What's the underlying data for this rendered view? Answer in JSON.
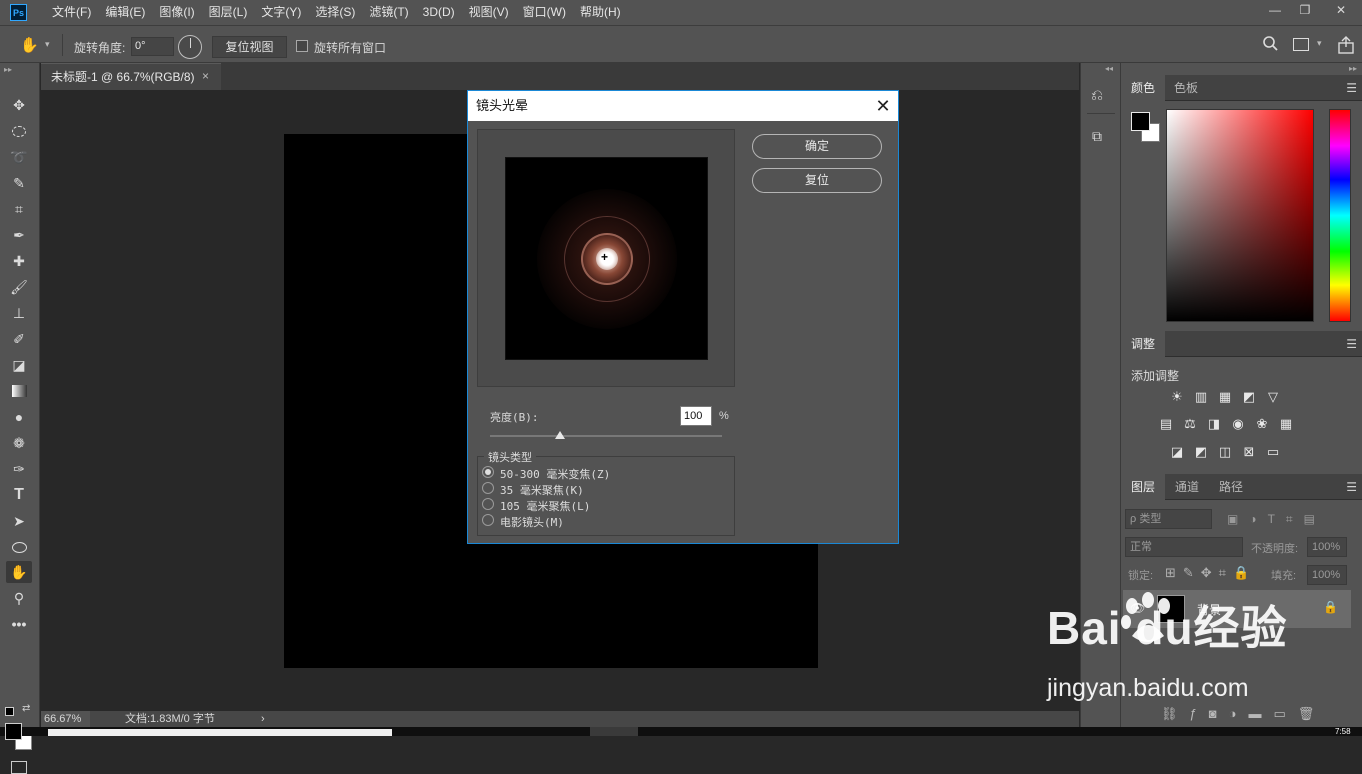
{
  "app": {
    "logo": "Ps"
  },
  "menubar": {
    "items": [
      "文件(F)",
      "编辑(E)",
      "图像(I)",
      "图层(L)",
      "文字(Y)",
      "选择(S)",
      "滤镜(T)",
      "3D(D)",
      "视图(V)",
      "窗口(W)",
      "帮助(H)"
    ]
  },
  "window_controls": {
    "minimize": "—",
    "restore": "❐",
    "close": "✕"
  },
  "options_bar": {
    "tool_icon": "rotate-view-icon",
    "rotate_label": "旋转角度:",
    "rotate_value": "0°",
    "reset_view_label": "复位视图",
    "rotate_all_label": "旋转所有窗口",
    "rotate_all_checked": false
  },
  "document": {
    "tab_title": "未标题-1 @ 66.7%(RGB/8)",
    "tab_close": "×",
    "zoom": "66.67%",
    "doc_info": "文档:1.83M/0 字节",
    "status_arrow": "›"
  },
  "panels": {
    "color_tabs": [
      "颜色",
      "色板"
    ],
    "adjust_tab": "调整",
    "add_adjust_label": "添加调整",
    "layers_tabs": [
      "图层",
      "通道",
      "路径"
    ],
    "layer_filter_placeholder": "ρ 类型",
    "blend_mode": "正常",
    "opacity_label": "不透明度:",
    "opacity_value": "100%",
    "lock_label": "锁定:",
    "fill_label": "填充:",
    "fill_value": "100%",
    "layer_name": "背景"
  },
  "dialog": {
    "title": "镜头光晕",
    "ok_label": "确定",
    "reset_label": "复位",
    "brightness_label": "亮度(B):",
    "brightness_value": "100",
    "brightness_unit": "%",
    "brightness_fraction": 0.3,
    "lens_type_label": "镜头类型",
    "lens_options": [
      "50-300 毫米变焦(Z)",
      "35 毫米聚焦(K)",
      "105 毫米聚焦(L)",
      "电影镜头(M)"
    ],
    "lens_selected": 0
  },
  "watermark": {
    "logo_text": "Bai  du经验",
    "url": "jingyan.baidu.com"
  },
  "taskbar": {
    "time": "7:58"
  }
}
